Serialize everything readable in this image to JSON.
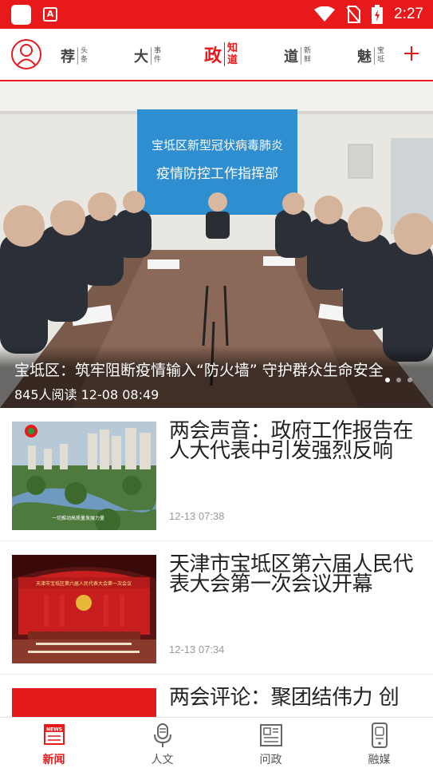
{
  "status_bar": {
    "time": "2:27",
    "app_icon_2": "A",
    "icons": [
      "app-white-square-icon",
      "app-a-icon",
      "wifi-icon",
      "no-sim-icon",
      "battery-charging-icon"
    ]
  },
  "channels": [
    {
      "big": "荐",
      "small1": "头",
      "small2": "条",
      "active": false
    },
    {
      "big": "大",
      "small1": "事",
      "small2": "件",
      "active": false
    },
    {
      "big": "政",
      "small1": "知",
      "small2": "道",
      "active": true
    },
    {
      "big": "道",
      "small1": "新",
      "small2": "鲜",
      "active": false
    },
    {
      "big": "魅",
      "small1": "宝",
      "small2": "坻",
      "active": false
    }
  ],
  "banner": {
    "sign_line1": "宝坻区新型冠状病毒肺炎",
    "sign_line2": "疫情防控工作指挥部",
    "title": "宝坻区：筑牢阻断疫情输入“防火墙” 守护群众生命安全",
    "meta": "845人阅读  12-08 08:49"
  },
  "news": [
    {
      "title": "两会声音：政府工作报告在人大代表中引发强烈反响",
      "time": "12-13 07:38",
      "thumb_caption": "一切推动高质量发展力量"
    },
    {
      "title": "天津市宝坻区第六届人民代表大会第一次会议开幕",
      "time": "12-13 07:34",
      "thumb_banner": "天津市宝坻区第六届人民代表大会第一次会议"
    },
    {
      "title": "两会评论：聚团结伟力 创",
      "time": ""
    }
  ],
  "tabs": [
    {
      "label": "新闻",
      "icon": "newspaper-icon",
      "active": true
    },
    {
      "label": "人文",
      "icon": "microphone-icon",
      "active": false
    },
    {
      "label": "问政",
      "icon": "document-icon",
      "active": false
    },
    {
      "label": "融媒",
      "icon": "mobile-media-icon",
      "active": false
    }
  ],
  "colors": {
    "brand_red": "#e8191b",
    "text": "#222222",
    "muted": "#999999"
  }
}
